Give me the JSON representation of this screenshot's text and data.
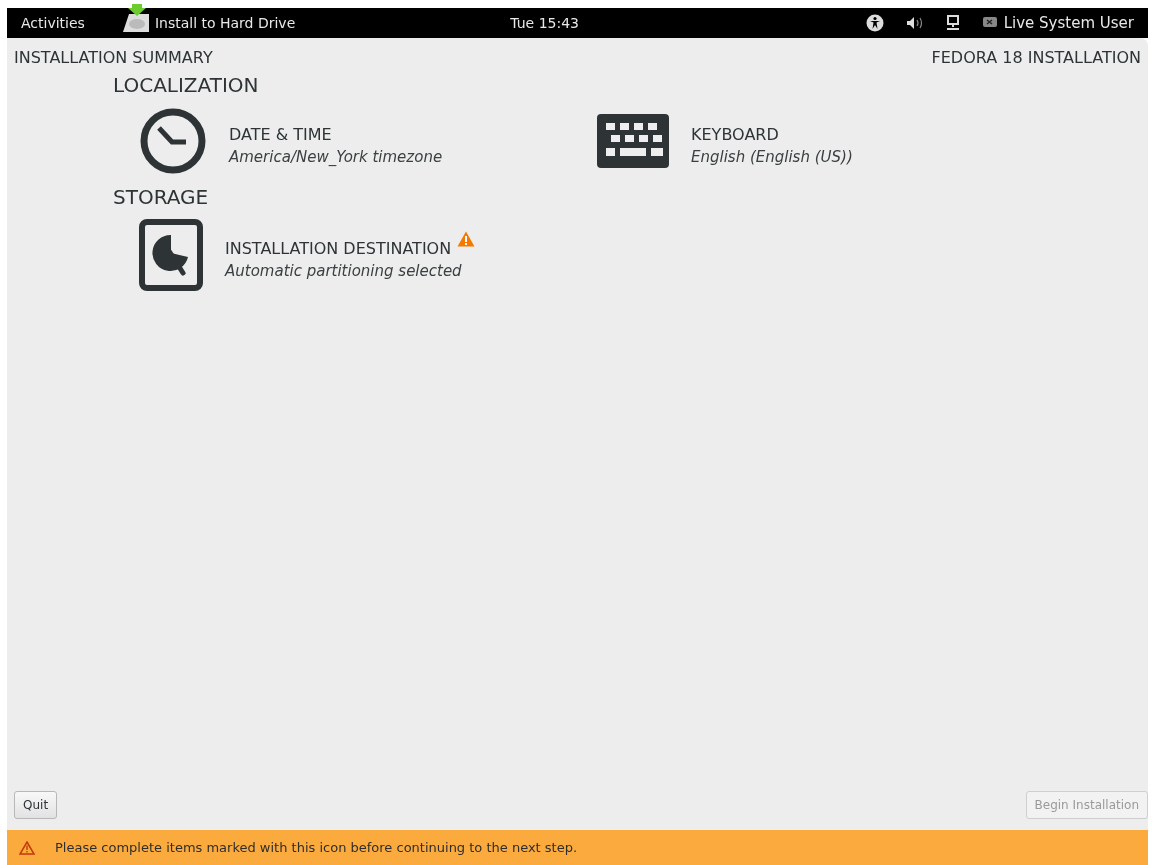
{
  "top_bar": {
    "activities": "Activities",
    "app_name": "Install to Hard Drive",
    "clock": "Tue 15:43",
    "user": "Live System User"
  },
  "window": {
    "title": "INSTALLATION SUMMARY",
    "product": "FEDORA 18 INSTALLATION"
  },
  "sections": [
    {
      "title": "LOCALIZATION",
      "spokes": [
        {
          "kind": "clock",
          "title": "DATE & TIME",
          "status": "America/New_York timezone",
          "warning": false
        },
        {
          "kind": "keyboard",
          "title": "KEYBOARD",
          "status": "English (English (US))",
          "warning": false
        }
      ]
    },
    {
      "title": "STORAGE",
      "spokes": [
        {
          "kind": "disk",
          "title": "INSTALLATION DESTINATION",
          "status": "Automatic partitioning selected",
          "warning": true
        }
      ]
    }
  ],
  "buttons": [
    {
      "label": "Quit",
      "disabled": false
    },
    {
      "label": "Begin Installation",
      "disabled": true
    }
  ],
  "warning_bar": {
    "message": "Please complete items marked with this icon before continuing to the next step."
  }
}
